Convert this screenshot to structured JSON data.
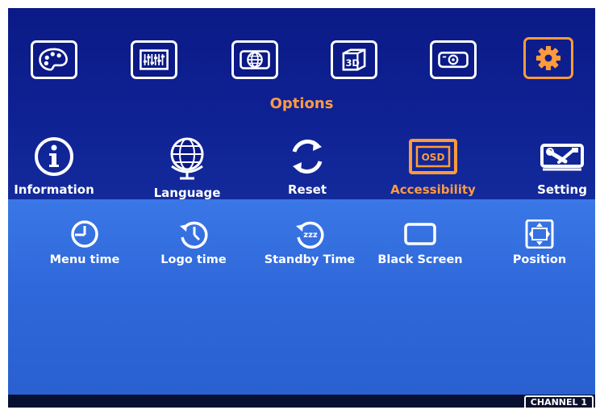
{
  "top_tabs": [
    {
      "icon": "palette-icon"
    },
    {
      "icon": "equalizer-icon"
    },
    {
      "icon": "globe-icon"
    },
    {
      "icon": "3d-cube-icon"
    },
    {
      "icon": "projector-icon"
    },
    {
      "icon": "gear-icon",
      "selected": true
    }
  ],
  "menu_title": "Options",
  "options": [
    {
      "label": "Information",
      "icon": "info-icon"
    },
    {
      "label": "Language",
      "icon": "globe-stand-icon"
    },
    {
      "label": "Reset",
      "icon": "refresh-icon"
    },
    {
      "label": "Accessibility",
      "icon": "osd-icon",
      "selected": true
    },
    {
      "label": "Setting",
      "icon": "tools-icon"
    }
  ],
  "osd_badge": "OSD",
  "submenu": [
    {
      "label": "Menu time",
      "icon": "clock-icon"
    },
    {
      "label": "Logo time",
      "icon": "history-clock-icon"
    },
    {
      "label": "Standby Time",
      "icon": "sleep-icon"
    },
    {
      "label": "Black Screen",
      "icon": "screen-icon"
    },
    {
      "label": "Position",
      "icon": "position-icon"
    }
  ],
  "sleep_glyph": "zzz",
  "channel_label": "CHANNEL 1",
  "colors": {
    "top_bg": "#0f1f8e",
    "lower_bg": "#3a77e6",
    "accent": "#ff9a45",
    "text": "#ffffff"
  }
}
